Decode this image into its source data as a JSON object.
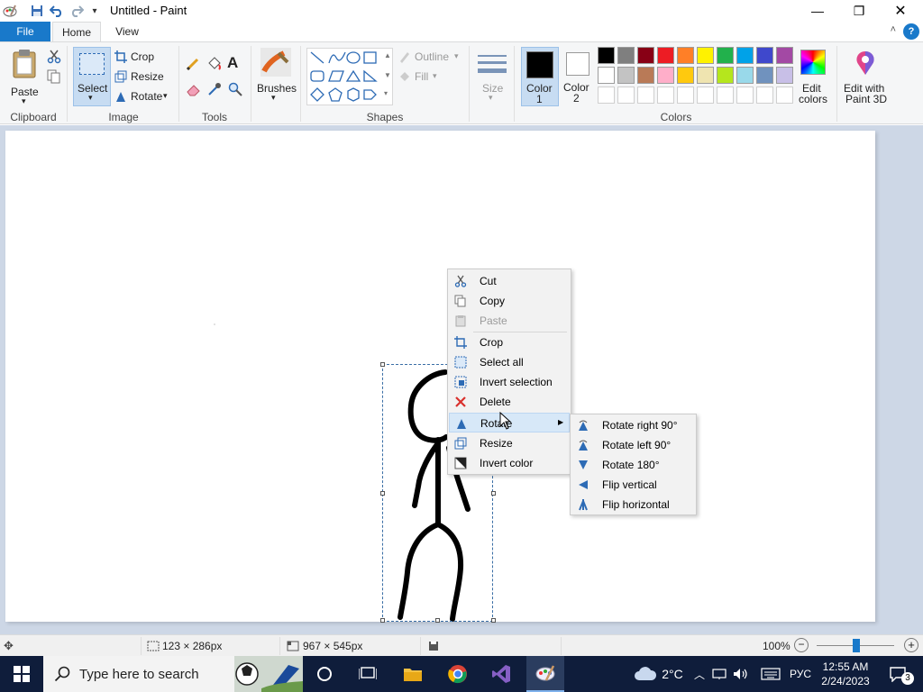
{
  "app": {
    "title": "Untitled - Paint",
    "minimize_glyph": "—",
    "maximize_glyph": "❐",
    "close_glyph": "✕"
  },
  "tabs": {
    "file": "File",
    "home": "Home",
    "view": "View",
    "help_glyph": "?",
    "collapse_glyph": "˄"
  },
  "ribbon": {
    "clipboard": {
      "paste": "Paste",
      "group": "Clipboard"
    },
    "image": {
      "select": "Select",
      "crop": "Crop",
      "resize": "Resize",
      "rotate": "Rotate",
      "group": "Image"
    },
    "tools": {
      "group": "Tools",
      "text_glyph": "A"
    },
    "brushes": {
      "label": "Brushes"
    },
    "shapes": {
      "outline": "Outline",
      "fill": "Fill",
      "group": "Shapes"
    },
    "size": {
      "label": "Size"
    },
    "color1": {
      "label_a": "Color",
      "label_b": "1"
    },
    "color2": {
      "label_a": "Color",
      "label_b": "2"
    },
    "colors_group": "Colors",
    "edit_colors": {
      "label_a": "Edit",
      "label_b": "colors"
    },
    "edit_paint3d": {
      "label_a": "Edit with",
      "label_b": "Paint 3D"
    },
    "palette_row1": [
      "#000000",
      "#7f7f7f",
      "#880015",
      "#ed1c24",
      "#ff7f27",
      "#fff200",
      "#22b14c",
      "#00a2e8",
      "#3f48cc",
      "#a349a4"
    ],
    "palette_row2": [
      "#ffffff",
      "#c3c3c3",
      "#b97a57",
      "#ffaec9",
      "#ffc90e",
      "#efe4b0",
      "#b5e61d",
      "#99d9ea",
      "#7092be",
      "#c8bfe7"
    ]
  },
  "context_menu": {
    "items": [
      {
        "label": "Cut",
        "icon": "scissors-icon",
        "enabled": true
      },
      {
        "label": "Copy",
        "icon": "copy-icon",
        "enabled": true
      },
      {
        "label": "Paste",
        "icon": "paste-icon",
        "enabled": false
      },
      {
        "label": "Crop",
        "icon": "crop-icon",
        "enabled": true
      },
      {
        "label": "Select all",
        "icon": "select-all-icon",
        "enabled": true
      },
      {
        "label": "Invert selection",
        "icon": "invert-selection-icon",
        "enabled": true
      },
      {
        "label": "Delete",
        "icon": "delete-icon",
        "enabled": true
      },
      {
        "label": "Rotate",
        "icon": "rotate-icon",
        "enabled": true,
        "has_submenu": true
      },
      {
        "label": "Resize",
        "icon": "resize-icon",
        "enabled": true
      },
      {
        "label": "Invert color",
        "icon": "invert-color-icon",
        "enabled": true
      }
    ],
    "submenu_arrow": "▶"
  },
  "rotate_submenu": {
    "items": [
      {
        "label": "Rotate right 90°",
        "icon": "rotate-right-icon"
      },
      {
        "label": "Rotate left 90°",
        "icon": "rotate-left-icon"
      },
      {
        "label": "Rotate 180°",
        "icon": "rotate-180-icon"
      },
      {
        "label": "Flip vertical",
        "icon": "flip-vertical-icon"
      },
      {
        "label": "Flip horizontal",
        "icon": "flip-horizontal-icon"
      }
    ]
  },
  "status": {
    "selection_size": "123 × 286px",
    "canvas_size": "967 × 545px",
    "zoom": "100%",
    "zoom_out": "−",
    "zoom_in": "+"
  },
  "taskbar": {
    "search_placeholder": "Type here to search",
    "weather": "2°C",
    "language": "РУС",
    "time": "12:55 AM",
    "date": "2/24/2023",
    "notification_count": "3"
  },
  "colors": {
    "accent": "#1979ca",
    "taskbar": "#0f1d3b",
    "canvas_bg": "#cdd7e6"
  }
}
